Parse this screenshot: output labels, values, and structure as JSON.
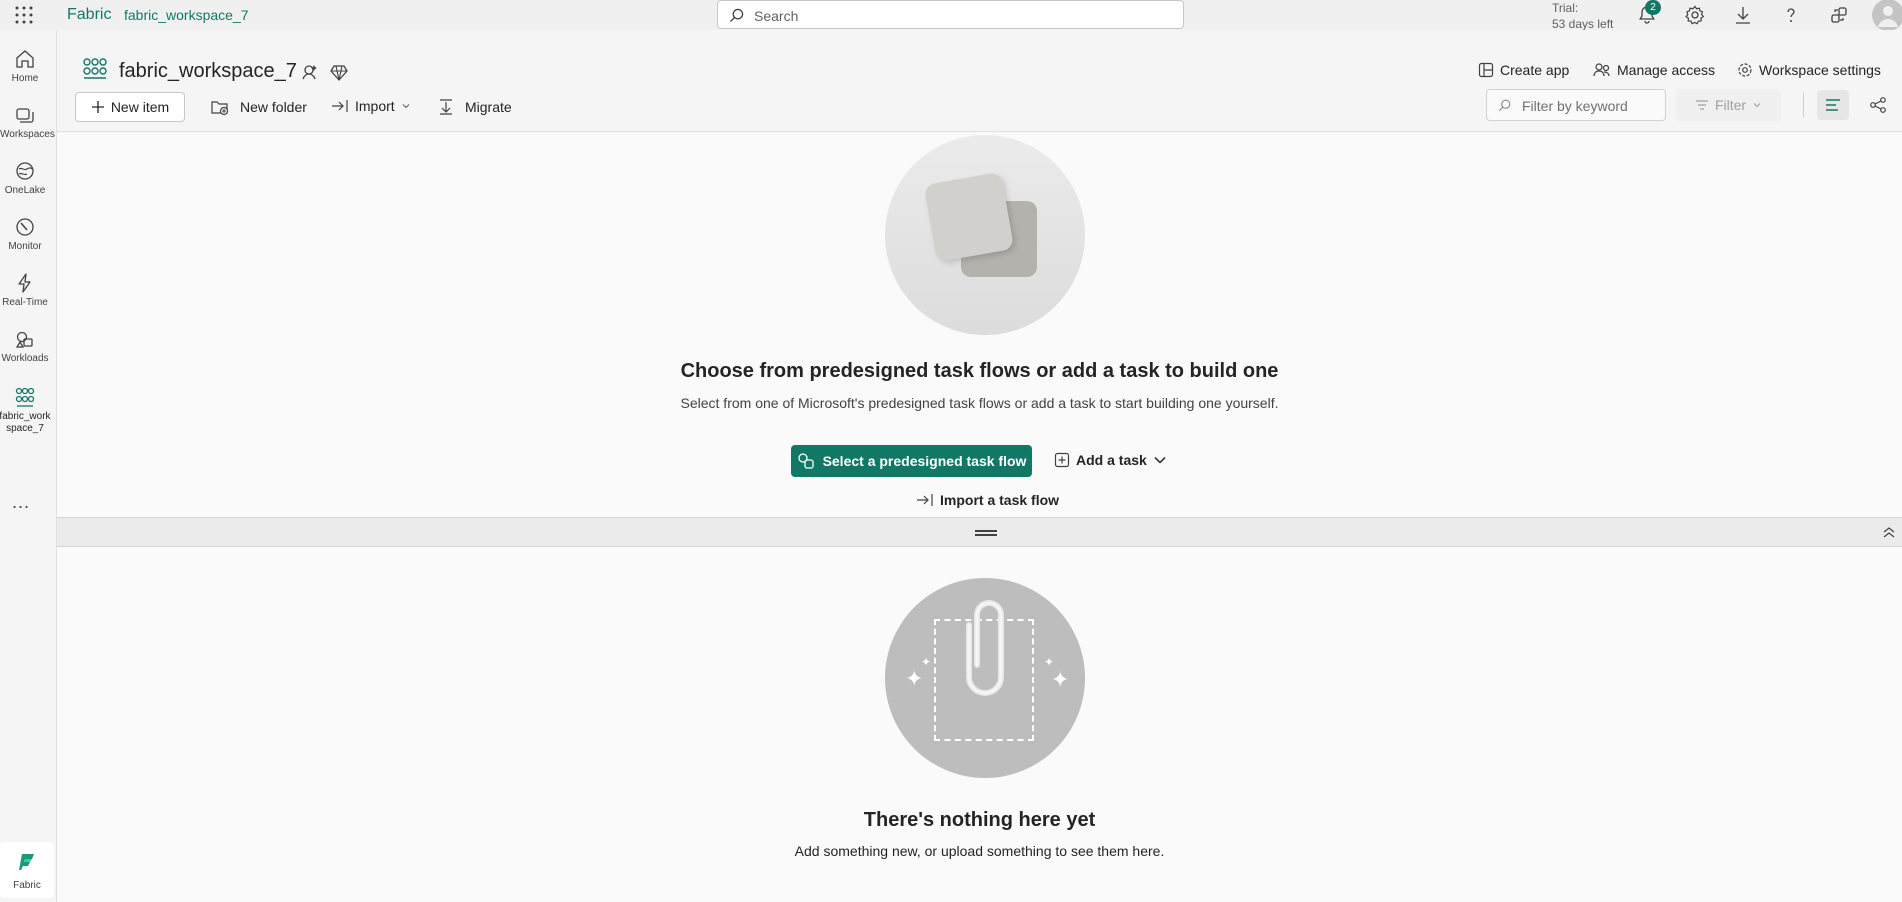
{
  "topbar": {
    "brand": "Fabric",
    "breadcrumb": "fabric_workspace_7",
    "search_placeholder": "Search",
    "trial_line1": "Trial:",
    "trial_line2": "53 days left",
    "notification_count": "2"
  },
  "sidebar": {
    "items": [
      {
        "label": "Home",
        "icon": "home-icon"
      },
      {
        "label": "Workspaces",
        "icon": "workspaces-icon"
      },
      {
        "label": "OneLake",
        "icon": "onelake-icon"
      },
      {
        "label": "Monitor",
        "icon": "monitor-icon"
      },
      {
        "label": "Real-Time",
        "icon": "lightning-icon"
      },
      {
        "label": "Workloads",
        "icon": "workloads-icon"
      },
      {
        "label": "fabric_work space_7",
        "icon": "workspace-icon"
      }
    ],
    "more": "...",
    "bottom_label": "Fabric"
  },
  "header": {
    "workspace_title": "fabric_workspace_7",
    "create_app": "Create app",
    "manage_access": "Manage access",
    "workspace_settings": "Workspace settings",
    "new_item": "New item",
    "new_folder": "New folder",
    "import": "Import",
    "migrate": "Migrate",
    "filter_placeholder": "Filter by keyword",
    "filter": "Filter"
  },
  "taskflow": {
    "title": "Choose from predesigned task flows or add a task to build one",
    "subtitle": "Select from one of Microsoft's predesigned task flows or add a task to start building one yourself.",
    "primary_button": "Select a predesigned task flow",
    "add_task": "Add a task",
    "import_flow": "Import a task flow"
  },
  "empty": {
    "title": "There's nothing here yet",
    "subtitle": "Add something new, or upload something to see them here."
  },
  "colors": {
    "accent": "#117865",
    "background": "#f5f5f5"
  }
}
